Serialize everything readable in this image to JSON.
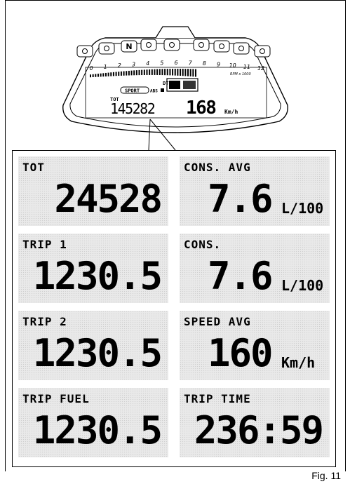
{
  "dashboard": {
    "icons": [
      "turn-left-icon",
      "oil-pressure-icon",
      "neutral-icon",
      "abs-icon",
      "highbeam-icon",
      "fuel-icon",
      "high-beam-icon",
      "engine-icon",
      "turn-right-icon"
    ],
    "neutral_letter": "N",
    "tach_ticks": [
      "0",
      "1",
      "2",
      "3",
      "4",
      "5",
      "6",
      "7",
      "8",
      "9",
      "10",
      "11",
      "12"
    ],
    "rpm_unit": "RPM x 1000",
    "dtc": "DTC 5",
    "abs": "ABS",
    "riding_mode": "SPORT",
    "tot_label": "TOT",
    "odometer": "145282",
    "speed": "168",
    "speed_unit": "Km/h"
  },
  "panel": {
    "cells": [
      {
        "label": "TOT",
        "value": "24528",
        "unit": ""
      },
      {
        "label": "CONS. AVG",
        "value": "7.6",
        "unit": "L/100"
      },
      {
        "label": "TRIP 1",
        "value": "1230.5",
        "unit": ""
      },
      {
        "label": "CONS.",
        "value": "7.6",
        "unit": "L/100"
      },
      {
        "label": "TRIP 2",
        "value": "1230.5",
        "unit": ""
      },
      {
        "label": "SPEED AVG",
        "value": "160",
        "unit": "Km/h"
      },
      {
        "label": "TRIP FUEL",
        "value": "1230.5",
        "unit": ""
      },
      {
        "label": "TRIP TIME",
        "value": "236:59",
        "unit": ""
      }
    ]
  },
  "caption": "Fig. 11"
}
